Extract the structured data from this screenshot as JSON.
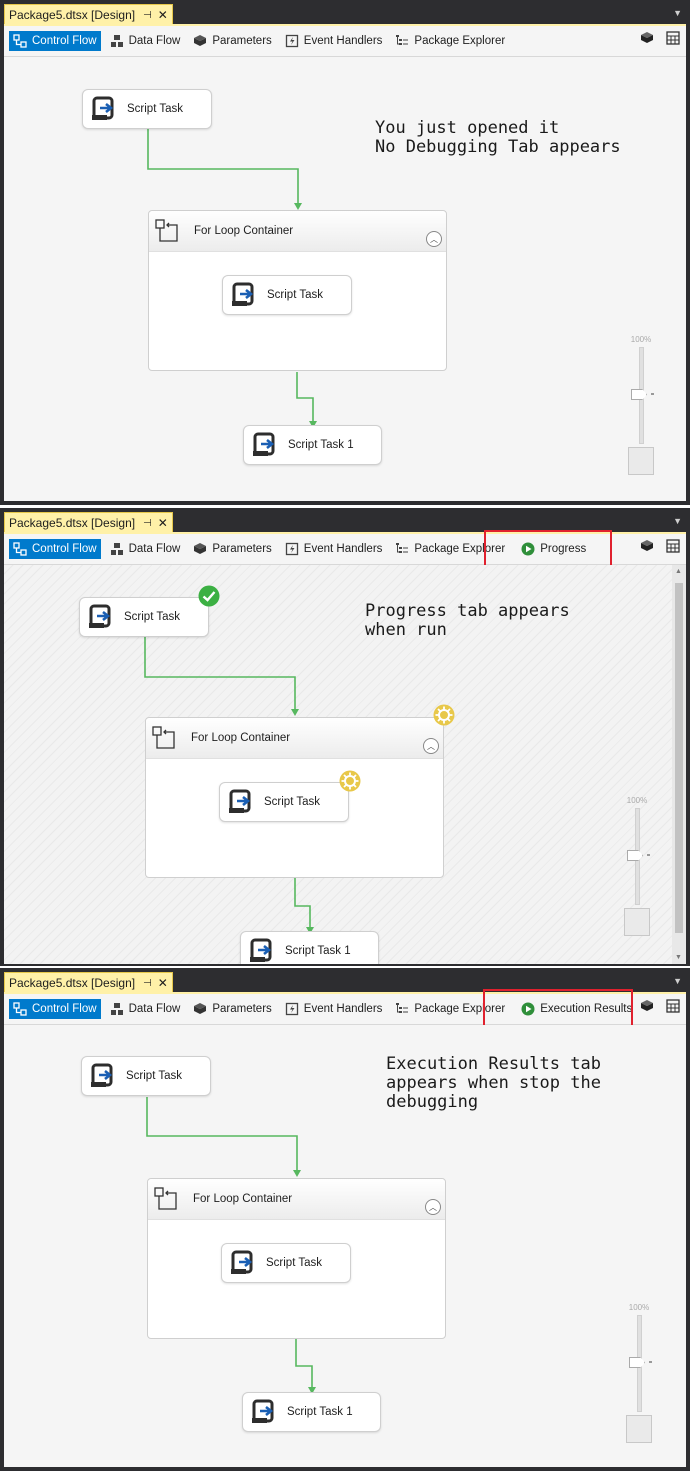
{
  "panels": [
    {
      "tab_title": "Package5.dtsx [Design]",
      "toolbar": {
        "control_flow": "Control Flow",
        "data_flow": "Data Flow",
        "parameters": "Parameters",
        "event_handlers": "Event Handlers",
        "package_explorer": "Package Explorer"
      },
      "tasks": {
        "script_task_top": "Script Task",
        "loop_container": "For Loop Container",
        "script_task_inner": "Script Task",
        "script_task_1": "Script Task 1"
      },
      "annotation": "You just opened it\nNo Debugging Tab appears",
      "zoom_label": "100%"
    },
    {
      "tab_title": "Package5.dtsx [Design]",
      "toolbar": {
        "control_flow": "Control Flow",
        "data_flow": "Data Flow",
        "parameters": "Parameters",
        "event_handlers": "Event Handlers",
        "package_explorer": "Package Explorer",
        "extra_tab": "Progress"
      },
      "tasks": {
        "script_task_top": "Script Task",
        "loop_container": "For Loop Container",
        "script_task_inner": "Script Task",
        "script_task_1": "Script Task 1"
      },
      "annotation": "Progress tab appears\nwhen run",
      "zoom_label": "100%"
    },
    {
      "tab_title": "Package5.dtsx [Design]",
      "toolbar": {
        "control_flow": "Control Flow",
        "data_flow": "Data Flow",
        "parameters": "Parameters",
        "event_handlers": "Event Handlers",
        "package_explorer": "Package Explorer",
        "extra_tab": "Execution Results"
      },
      "tasks": {
        "script_task_top": "Script Task",
        "loop_container": "For Loop Container",
        "script_task_inner": "Script Task",
        "script_task_1": "Script Task 1"
      },
      "annotation": "Execution Results tab\nappears when stop the\ndebugging",
      "zoom_label": "100%"
    }
  ],
  "colors": {
    "active_tab": "#007acc",
    "doc_tab": "#fff1a8",
    "connector": "#57b85f",
    "highlight_box": "#e0212e",
    "success": "#3cb043",
    "running": "#e8c84a"
  }
}
